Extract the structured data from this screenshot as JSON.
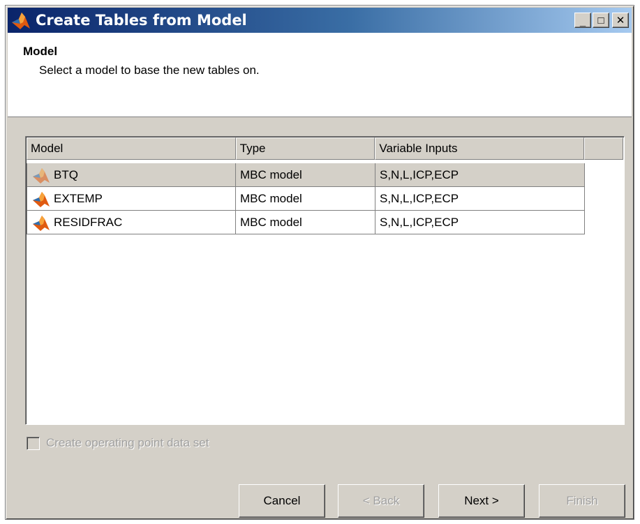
{
  "window": {
    "title": "Create Tables from Model",
    "controls": {
      "minimize": "_",
      "maximize": "□",
      "close": "✕"
    }
  },
  "header": {
    "title": "Model",
    "subtitle": "Select a model to base the new tables on."
  },
  "table": {
    "columns": [
      "Model",
      "Type",
      "Variable Inputs"
    ],
    "rows": [
      {
        "model": "BTQ",
        "type": "MBC model",
        "inputs": "S,N,L,ICP,ECP",
        "icon": "matlab-model-icon-faded",
        "selected": true
      },
      {
        "model": "EXTEMP",
        "type": "MBC model",
        "inputs": "S,N,L,ICP,ECP",
        "icon": "matlab-model-icon",
        "selected": false
      },
      {
        "model": "RESIDFRAC",
        "type": "MBC model",
        "inputs": "S,N,L,ICP,ECP",
        "icon": "matlab-model-icon",
        "selected": false
      }
    ]
  },
  "options": {
    "create_op_label": "Create operating point data set",
    "create_op_checked": false,
    "create_op_enabled": false
  },
  "buttons": {
    "cancel": "Cancel",
    "back": "< Back",
    "next": "Next >",
    "finish": "Finish"
  },
  "colors": {
    "titlebar_start": "#0a246a",
    "titlebar_end": "#a6caf0",
    "dialog_bg": "#d4d0c8"
  }
}
